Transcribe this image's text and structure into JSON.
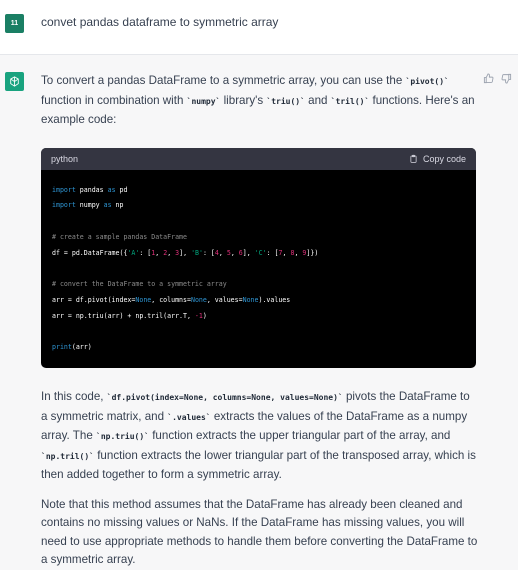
{
  "user": {
    "avatar_text": "11",
    "message": "convet pandas dataframe to symmetric array"
  },
  "assistant": {
    "p1_a": "To convert a pandas DataFrame to a symmetric array, you can use the ",
    "p1_pivot": "`pivot()`",
    "p1_b": " function in combination with ",
    "p1_numpy": "`numpy`",
    "p1_c": " library's ",
    "p1_triu": "`triu()`",
    "p1_d": " and ",
    "p1_tril": "`tril()`",
    "p1_e": " functions. Here's an example code:",
    "code": {
      "language": "python",
      "copy_label": "Copy code",
      "lines": [
        [
          {
            "t": "import",
            "c": "kw"
          },
          {
            "t": " pandas "
          },
          {
            "t": "as",
            "c": "kw"
          },
          {
            "t": " pd"
          }
        ],
        [
          {
            "t": "import",
            "c": "kw"
          },
          {
            "t": " numpy "
          },
          {
            "t": "as",
            "c": "kw"
          },
          {
            "t": " np"
          }
        ],
        [],
        [
          {
            "t": "# create a sample pandas DataFrame",
            "c": "cm"
          }
        ],
        [
          {
            "t": "df = pd.DataFrame({"
          },
          {
            "t": "'A'",
            "c": "str"
          },
          {
            "t": ": ["
          },
          {
            "t": "1",
            "c": "num"
          },
          {
            "t": ", "
          },
          {
            "t": "2",
            "c": "num"
          },
          {
            "t": ", "
          },
          {
            "t": "3",
            "c": "num"
          },
          {
            "t": "], "
          },
          {
            "t": "'B'",
            "c": "str"
          },
          {
            "t": ": ["
          },
          {
            "t": "4",
            "c": "num"
          },
          {
            "t": ", "
          },
          {
            "t": "5",
            "c": "num"
          },
          {
            "t": ", "
          },
          {
            "t": "6",
            "c": "num"
          },
          {
            "t": "], "
          },
          {
            "t": "'C'",
            "c": "str"
          },
          {
            "t": ": ["
          },
          {
            "t": "7",
            "c": "num"
          },
          {
            "t": ", "
          },
          {
            "t": "8",
            "c": "num"
          },
          {
            "t": ", "
          },
          {
            "t": "9",
            "c": "num"
          },
          {
            "t": "]})"
          }
        ],
        [],
        [
          {
            "t": "# convert the DataFrame to a symmetric array",
            "c": "cm"
          }
        ],
        [
          {
            "t": "arr = df.pivot(index="
          },
          {
            "t": "None",
            "c": "kw"
          },
          {
            "t": ", columns="
          },
          {
            "t": "None",
            "c": "kw"
          },
          {
            "t": ", values="
          },
          {
            "t": "None",
            "c": "kw"
          },
          {
            "t": ").values"
          }
        ],
        [
          {
            "t": "arr = np.triu(arr) + np.tril(arr.T, "
          },
          {
            "t": "-1",
            "c": "num"
          },
          {
            "t": ")"
          }
        ],
        [],
        [
          {
            "t": "print",
            "c": "kw"
          },
          {
            "t": "(arr)"
          }
        ]
      ]
    },
    "p2_a": "In this code, ",
    "p2_pivot": "`df.pivot(index=None, columns=None, values=None)`",
    "p2_b": " pivots the DataFrame to a symmetric matrix, and ",
    "p2_values": "`.values`",
    "p2_c": " extracts the values of the DataFrame as a numpy array. The ",
    "p2_triu": "`np.triu()`",
    "p2_d": " function extracts the upper triangular part of the array, and ",
    "p2_tril": "`np.tril()`",
    "p2_e": " function extracts the lower triangular part of the transposed array, which is then added together to form a symmetric array.",
    "p3": "Note that this method assumes that the DataFrame has already been cleaned and contains no missing values or NaNs. If the DataFrame has missing values, you will need to use appropriate methods to handle them before converting the DataFrame to a symmetric array."
  },
  "icons": {
    "assistant_avatar": "openai-logo-icon",
    "thumbs_up": "thumbs-up-icon",
    "thumbs_down": "thumbs-down-icon",
    "copy": "clipboard-icon"
  },
  "colors": {
    "user_avatar": "#1a7f64",
    "assistant_avatar": "#19a37f",
    "code_bg": "#000000",
    "code_header_bg": "#343541"
  }
}
